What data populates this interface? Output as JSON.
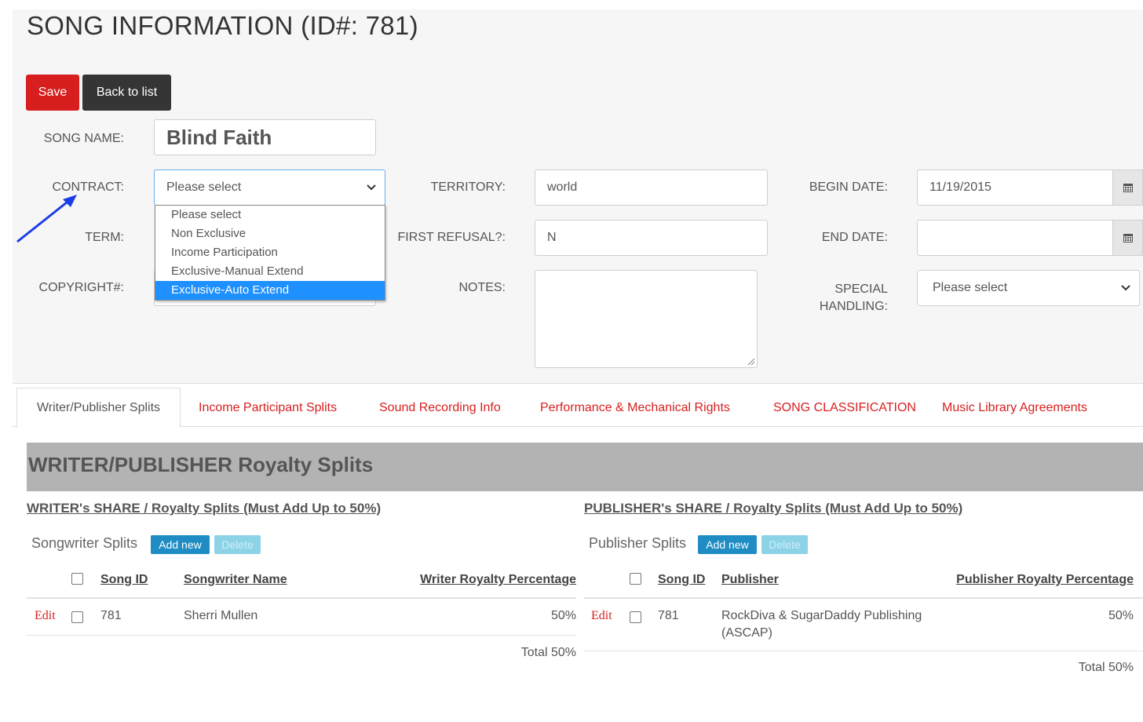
{
  "page": {
    "title": "SONG INFORMATION (ID#: 781)",
    "save_label": "Save",
    "back_label": "Back to list"
  },
  "form": {
    "song_name_label": "SONG NAME:",
    "song_name_value": "Blind Faith",
    "contract_label": "CONTRACT:",
    "contract_value": "Please select",
    "contract_options": [
      "Please select",
      "Non Exclusive",
      "Income Participation",
      "Exclusive-Manual Extend",
      "Exclusive-Auto Extend"
    ],
    "contract_highlighted": "Exclusive-Auto Extend",
    "term_label": "TERM:",
    "copyright_label": "COPYRIGHT#:",
    "territory_label": "TERRITORY:",
    "territory_value": "world",
    "first_refusal_label": "FIRST REFUSAL?:",
    "first_refusal_value": "N",
    "notes_label": "NOTES:",
    "begin_date_label": "BEGIN DATE:",
    "begin_date_value": "11/19/2015",
    "end_date_label": "END DATE:",
    "end_date_value": "",
    "special_handling_label_1": "SPECIAL",
    "special_handling_label_2": "HANDLING:",
    "special_handling_value": "Please select"
  },
  "tabs": [
    {
      "label": "Writer/Publisher Splits",
      "active": true
    },
    {
      "label": "Income Participant Splits"
    },
    {
      "label": "Sound Recording Info"
    },
    {
      "label": "Performance & Mechanical Rights"
    },
    {
      "label": "SONG CLASSIFICATION"
    },
    {
      "label": "Music Library Agreements"
    }
  ],
  "section": {
    "title": "WRITER/PUBLISHER Royalty Splits"
  },
  "writer": {
    "share_title": "WRITER's SHARE / Royalty Splits (Must Add Up to 50%)",
    "splits_label": "Songwriter Splits",
    "add_new": "Add new",
    "delete": "Delete",
    "col_song_id": "Song ID",
    "col_name": "Songwriter Name",
    "col_pct": "Writer Royalty Percentage",
    "rows": [
      {
        "edit": "Edit",
        "song_id": "781",
        "name": "Sherri Mullen",
        "pct": "50%"
      }
    ],
    "total": "Total 50%"
  },
  "publisher": {
    "share_title": "PUBLISHER's SHARE / Royalty Splits (Must Add Up to 50%)",
    "splits_label": "Publisher Splits",
    "add_new": "Add new",
    "delete": "Delete",
    "col_song_id": "Song ID",
    "col_name": "Publisher",
    "col_pct": "Publisher Royalty Percentage",
    "rows": [
      {
        "edit": "Edit",
        "song_id": "781",
        "name_line1": "RockDiva & SugarDaddy Publishing",
        "name_line2": "(ASCAP)",
        "pct": "50%"
      }
    ],
    "total": "Total 50%"
  },
  "colors": {
    "accent_red": "#d71f1f",
    "button_dark": "#353535",
    "button_blue": "#1f8cc4",
    "highlight_blue": "#1e90ff",
    "section_gray": "#b3b3b3"
  }
}
